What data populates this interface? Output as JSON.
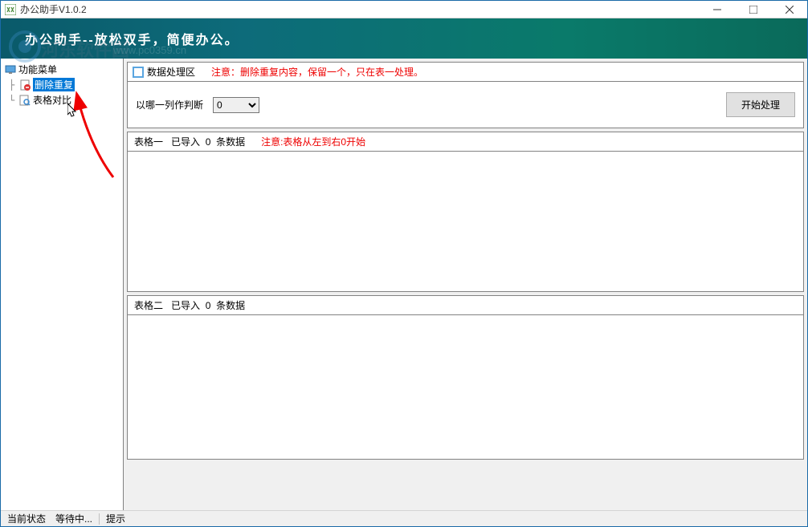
{
  "window": {
    "title": "办公助手V1.0.2"
  },
  "banner": {
    "text": "办公助手--放松双手，简便办公。",
    "watermark_site": "河东软件园",
    "watermark_url": "www.pc0359.cn"
  },
  "sidebar": {
    "root": "功能菜单",
    "items": [
      {
        "label": "删除重复",
        "selected": true
      },
      {
        "label": "表格对比",
        "selected": false
      }
    ]
  },
  "section": {
    "title": "数据处理区",
    "warning": "注意：删除重复内容，保留一个，只在表一处理。"
  },
  "controls": {
    "column_label": "以哪一列作判断",
    "column_value": "0",
    "process_btn": "开始处理"
  },
  "table1": {
    "name": "表格一",
    "import_label": "已导入",
    "count": "0",
    "count_suffix": "条数据",
    "warning": "注意:表格从左到右0开始"
  },
  "table2": {
    "name": "表格二",
    "import_label": "已导入",
    "count": "0",
    "count_suffix": "条数据"
  },
  "statusbar": {
    "state_label": "当前状态",
    "state_value": "等待中...",
    "hint_label": "提示"
  }
}
